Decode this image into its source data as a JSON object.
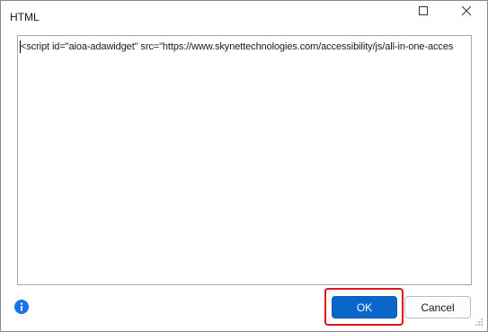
{
  "window": {
    "title": "HTML",
    "maximize_icon": "maximize-icon",
    "close_icon": "close-icon"
  },
  "editor": {
    "text": "<script id=\"aioa-adawidget\" src=\"https://www.skynettechnologies.com/accessibility/js/all-in-one-acces"
  },
  "footer": {
    "info_icon": "info-icon",
    "ok_label": "OK",
    "cancel_label": "Cancel"
  },
  "colors": {
    "ok_button": "#0a66c9",
    "highlight": "#e0141e",
    "info_icon": "#1a73e8"
  }
}
